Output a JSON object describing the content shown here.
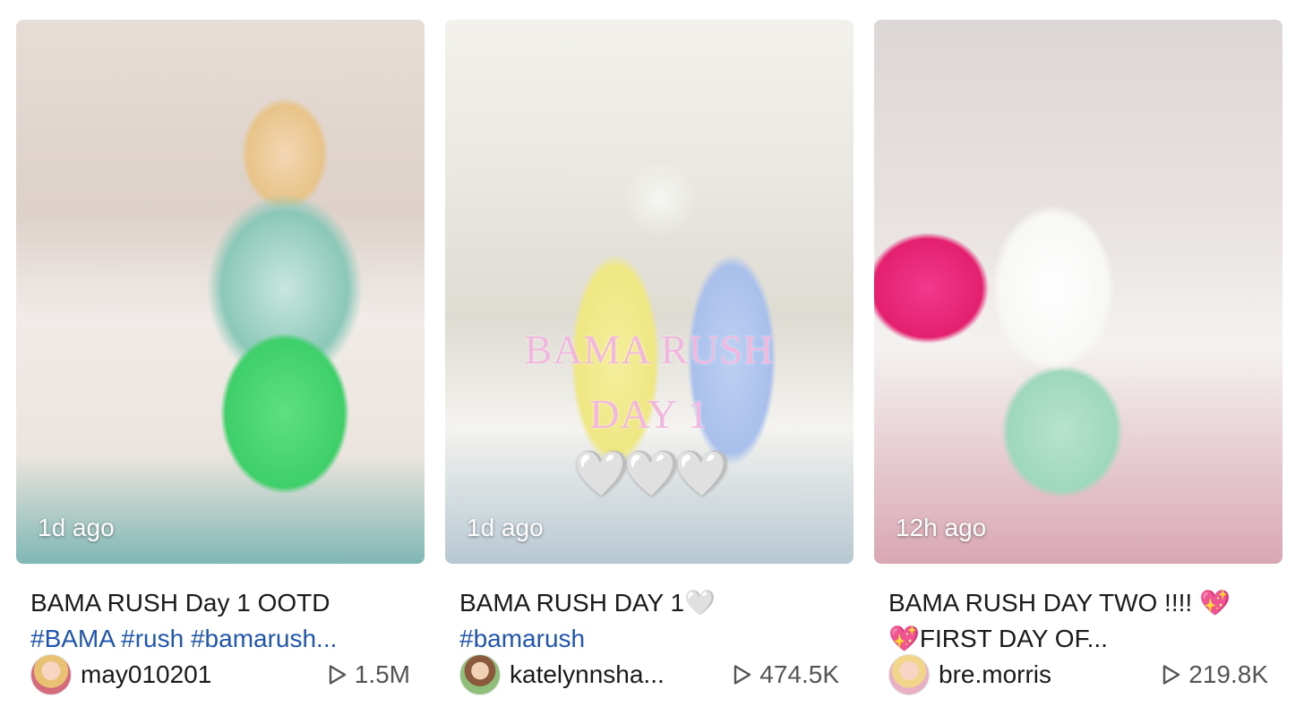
{
  "videos": [
    {
      "time_ago": "1d ago",
      "caption_line1": "BAMA RUSH Day 1 OOTD",
      "caption_line2": "#BAMA #rush #bamarush...",
      "author": "may010201",
      "views": "1.5M"
    },
    {
      "time_ago": "1d ago",
      "overlay_line1": "BAMA RUSH",
      "overlay_line2": "DAY 1",
      "overlay_hearts": "🤍🤍🤍",
      "caption_line1": "BAMA RUSH DAY 1🤍",
      "caption_line2": "#bamarush",
      "author": "katelynnsha...",
      "views": "474.5K"
    },
    {
      "time_ago": "12h ago",
      "caption_line1": "BAMA RUSH DAY TWO !!!! 💖",
      "caption_line2": "💖FIRST DAY OF...",
      "author": "bre.morris",
      "views": "219.8K"
    }
  ],
  "colors": {
    "hashtag": "#2056b0",
    "overlay_text": "#f2b7de"
  },
  "icons": {
    "views": "play-outline-icon"
  }
}
